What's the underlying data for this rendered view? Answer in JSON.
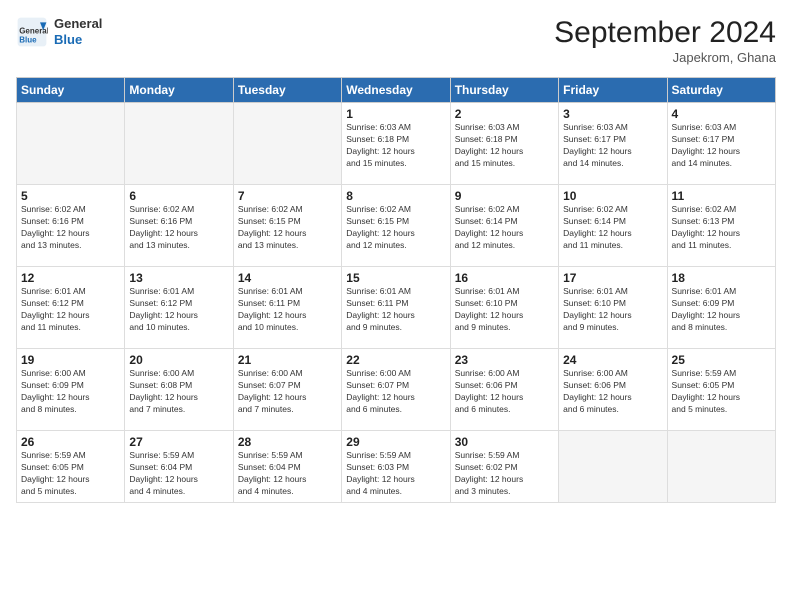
{
  "header": {
    "logo_general": "General",
    "logo_blue": "Blue",
    "title": "September 2024",
    "location": "Japekrom, Ghana"
  },
  "weekdays": [
    "Sunday",
    "Monday",
    "Tuesday",
    "Wednesday",
    "Thursday",
    "Friday",
    "Saturday"
  ],
  "days": [
    {
      "num": "",
      "info": ""
    },
    {
      "num": "",
      "info": ""
    },
    {
      "num": "",
      "info": ""
    },
    {
      "num": "1",
      "info": "Sunrise: 6:03 AM\nSunset: 6:18 PM\nDaylight: 12 hours\nand 15 minutes."
    },
    {
      "num": "2",
      "info": "Sunrise: 6:03 AM\nSunset: 6:18 PM\nDaylight: 12 hours\nand 15 minutes."
    },
    {
      "num": "3",
      "info": "Sunrise: 6:03 AM\nSunset: 6:17 PM\nDaylight: 12 hours\nand 14 minutes."
    },
    {
      "num": "4",
      "info": "Sunrise: 6:03 AM\nSunset: 6:17 PM\nDaylight: 12 hours\nand 14 minutes."
    },
    {
      "num": "5",
      "info": "Sunrise: 6:02 AM\nSunset: 6:16 PM\nDaylight: 12 hours\nand 13 minutes."
    },
    {
      "num": "6",
      "info": "Sunrise: 6:02 AM\nSunset: 6:16 PM\nDaylight: 12 hours\nand 13 minutes."
    },
    {
      "num": "7",
      "info": "Sunrise: 6:02 AM\nSunset: 6:15 PM\nDaylight: 12 hours\nand 13 minutes."
    },
    {
      "num": "8",
      "info": "Sunrise: 6:02 AM\nSunset: 6:15 PM\nDaylight: 12 hours\nand 12 minutes."
    },
    {
      "num": "9",
      "info": "Sunrise: 6:02 AM\nSunset: 6:14 PM\nDaylight: 12 hours\nand 12 minutes."
    },
    {
      "num": "10",
      "info": "Sunrise: 6:02 AM\nSunset: 6:14 PM\nDaylight: 12 hours\nand 11 minutes."
    },
    {
      "num": "11",
      "info": "Sunrise: 6:02 AM\nSunset: 6:13 PM\nDaylight: 12 hours\nand 11 minutes."
    },
    {
      "num": "12",
      "info": "Sunrise: 6:01 AM\nSunset: 6:12 PM\nDaylight: 12 hours\nand 11 minutes."
    },
    {
      "num": "13",
      "info": "Sunrise: 6:01 AM\nSunset: 6:12 PM\nDaylight: 12 hours\nand 10 minutes."
    },
    {
      "num": "14",
      "info": "Sunrise: 6:01 AM\nSunset: 6:11 PM\nDaylight: 12 hours\nand 10 minutes."
    },
    {
      "num": "15",
      "info": "Sunrise: 6:01 AM\nSunset: 6:11 PM\nDaylight: 12 hours\nand 9 minutes."
    },
    {
      "num": "16",
      "info": "Sunrise: 6:01 AM\nSunset: 6:10 PM\nDaylight: 12 hours\nand 9 minutes."
    },
    {
      "num": "17",
      "info": "Sunrise: 6:01 AM\nSunset: 6:10 PM\nDaylight: 12 hours\nand 9 minutes."
    },
    {
      "num": "18",
      "info": "Sunrise: 6:01 AM\nSunset: 6:09 PM\nDaylight: 12 hours\nand 8 minutes."
    },
    {
      "num": "19",
      "info": "Sunrise: 6:00 AM\nSunset: 6:09 PM\nDaylight: 12 hours\nand 8 minutes."
    },
    {
      "num": "20",
      "info": "Sunrise: 6:00 AM\nSunset: 6:08 PM\nDaylight: 12 hours\nand 7 minutes."
    },
    {
      "num": "21",
      "info": "Sunrise: 6:00 AM\nSunset: 6:07 PM\nDaylight: 12 hours\nand 7 minutes."
    },
    {
      "num": "22",
      "info": "Sunrise: 6:00 AM\nSunset: 6:07 PM\nDaylight: 12 hours\nand 6 minutes."
    },
    {
      "num": "23",
      "info": "Sunrise: 6:00 AM\nSunset: 6:06 PM\nDaylight: 12 hours\nand 6 minutes."
    },
    {
      "num": "24",
      "info": "Sunrise: 6:00 AM\nSunset: 6:06 PM\nDaylight: 12 hours\nand 6 minutes."
    },
    {
      "num": "25",
      "info": "Sunrise: 5:59 AM\nSunset: 6:05 PM\nDaylight: 12 hours\nand 5 minutes."
    },
    {
      "num": "26",
      "info": "Sunrise: 5:59 AM\nSunset: 6:05 PM\nDaylight: 12 hours\nand 5 minutes."
    },
    {
      "num": "27",
      "info": "Sunrise: 5:59 AM\nSunset: 6:04 PM\nDaylight: 12 hours\nand 4 minutes."
    },
    {
      "num": "28",
      "info": "Sunrise: 5:59 AM\nSunset: 6:04 PM\nDaylight: 12 hours\nand 4 minutes."
    },
    {
      "num": "29",
      "info": "Sunrise: 5:59 AM\nSunset: 6:03 PM\nDaylight: 12 hours\nand 4 minutes."
    },
    {
      "num": "30",
      "info": "Sunrise: 5:59 AM\nSunset: 6:02 PM\nDaylight: 12 hours\nand 3 minutes."
    },
    {
      "num": "",
      "info": ""
    },
    {
      "num": "",
      "info": ""
    },
    {
      "num": "",
      "info": ""
    }
  ]
}
